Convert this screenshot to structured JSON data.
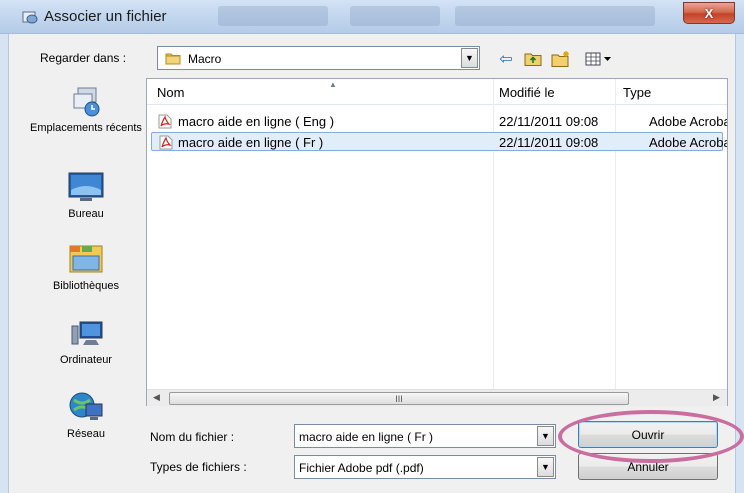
{
  "window": {
    "title": "Associer un fichier",
    "close_glyph": "X"
  },
  "toolbar": {
    "look_in_label": "Regarder dans :",
    "look_in_value": "Macro",
    "icons": [
      "back-arrow-icon",
      "up-folder-icon",
      "new-folder-icon",
      "view-menu-icon"
    ]
  },
  "places": [
    {
      "label": "Emplacements récents",
      "icon": "recent-places-icon"
    },
    {
      "label": "Bureau",
      "icon": "desktop-icon"
    },
    {
      "label": "Bibliothèques",
      "icon": "libraries-icon"
    },
    {
      "label": "Ordinateur",
      "icon": "computer-icon"
    },
    {
      "label": "Réseau",
      "icon": "network-icon"
    }
  ],
  "file_list": {
    "columns": [
      "Nom",
      "Modifié le",
      "Type"
    ],
    "rows": [
      {
        "name": "macro aide en ligne ( Eng )",
        "modified": "22/11/2011 09:08",
        "type": "Adobe Acrobat",
        "selected": false
      },
      {
        "name": "macro aide en ligne ( Fr )",
        "modified": "22/11/2011 09:08",
        "type": "Adobe Acrobat",
        "selected": true
      }
    ],
    "scroll_thumb_glyph": "III"
  },
  "form": {
    "filename_label": "Nom du fichier :",
    "filename_value": "macro aide en ligne ( Fr )",
    "filetype_label": "Types de fichiers :",
    "filetype_value": "Fichier Adobe pdf (.pdf)",
    "open_label": "Ouvrir",
    "cancel_label": "Annuler"
  },
  "colors": {
    "selection": "#e1edf9",
    "highlight_ring": "#c96e9f",
    "close_button": "#c2432b"
  }
}
